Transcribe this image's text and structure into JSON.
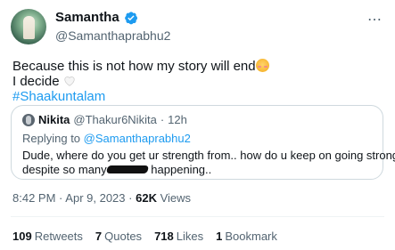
{
  "author": {
    "display_name": "Samantha",
    "handle": "@Samanthaprabhu2",
    "verified": true,
    "colors": {
      "verified_badge": "#1d9bf0"
    }
  },
  "tweet": {
    "line1": "Because this is not how my story will end",
    "line1_emoji": "smiling-face-with-blush",
    "line2": "I decide",
    "line2_emoji": "white-heart",
    "hashtag": "#Shaakuntalam",
    "colors": {
      "hashtag": "#1d9bf0"
    }
  },
  "quoted": {
    "display_name": "Nikita",
    "handle": "@Thakur6Nikita",
    "separator": "·",
    "time": "12h",
    "replying_prefix": "Replying to",
    "replying_to": "@Samanthaprabhu2",
    "text_line1": "Dude, where do you get ur strength from.. how do u keep on going strong",
    "text_line2_start": "despite so many",
    "text_line2_end": "happening.."
  },
  "meta": {
    "time": "8:42 PM",
    "separator1": "·",
    "date": "Apr 9, 2023",
    "separator2": "·",
    "views_count": "62K",
    "views_label": "Views"
  },
  "stats": [
    {
      "count": "109",
      "label": "Retweets"
    },
    {
      "count": "7",
      "label": "Quotes"
    },
    {
      "count": "718",
      "label": "Likes"
    },
    {
      "count": "1",
      "label": "Bookmark"
    }
  ]
}
